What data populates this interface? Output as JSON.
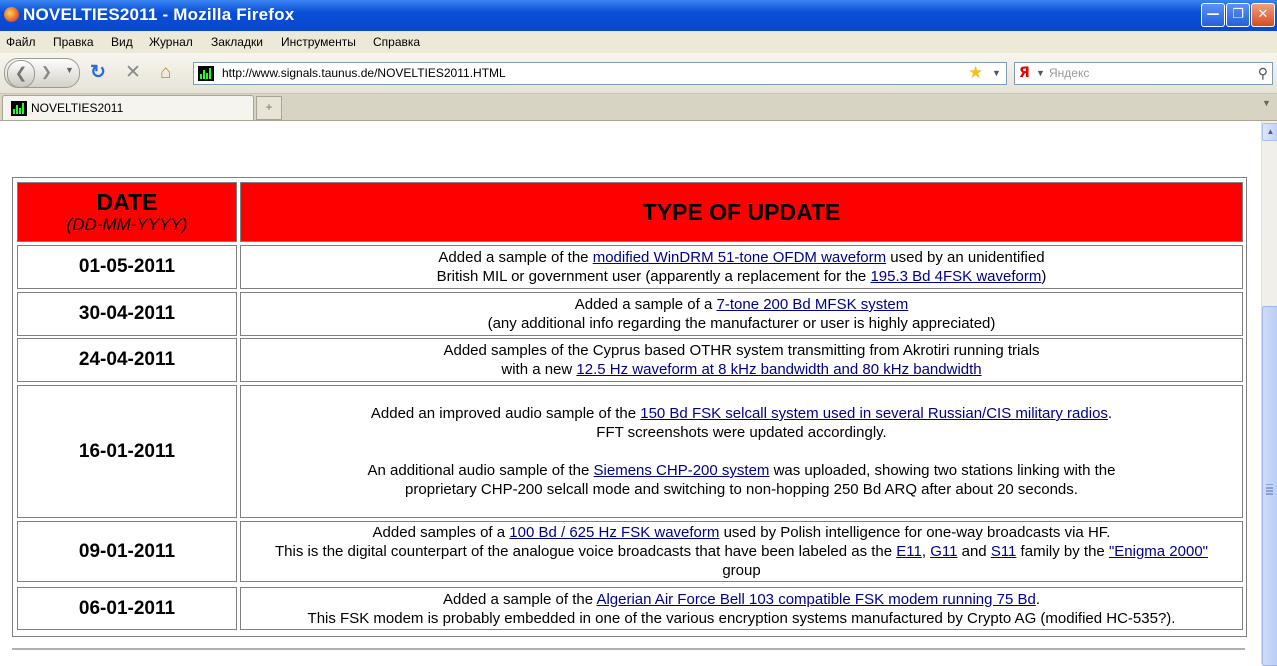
{
  "window": {
    "title": "NOVELTIES2011 - Mozilla Firefox",
    "minimize": "—",
    "maximize": "❐",
    "close": "✕"
  },
  "menu": [
    "Файл",
    "Правка",
    "Вид",
    "Журнал",
    "Закладки",
    "Инструменты",
    "Справка"
  ],
  "nav": {
    "url": "http://www.signals.taunus.de/NOVELTIES2011.HTML",
    "search_placeholder": "Яндекс",
    "search_engine": "Я"
  },
  "tabs": [
    {
      "label": "NOVELTIES2011"
    }
  ],
  "table": {
    "header": {
      "date": "DATE",
      "date_format": "(DD-MM-YYYY)",
      "type": "TYPE OF UPDATE"
    },
    "rows": [
      {
        "date": "01-05-2011",
        "lines": [
          [
            {
              "t": "Added a sample of the "
            },
            {
              "t": "modified WinDRM 51-tone OFDM waveform",
              "link": true
            },
            {
              "t": " used by an unidentified"
            }
          ],
          [
            {
              "t": "British MIL or government user (apparently a replacement for the "
            },
            {
              "t": "195.3 Bd 4FSK waveform",
              "link": true
            },
            {
              "t": ")"
            }
          ]
        ]
      },
      {
        "date": "30-04-2011",
        "lines": [
          [
            {
              "t": "Added a sample of a "
            },
            {
              "t": "7-tone 200 Bd MFSK system",
              "link": true
            }
          ],
          [
            {
              "t": "(any additional info regarding the manufacturer or user is highly appreciated)"
            }
          ]
        ]
      },
      {
        "date": "24-04-2011",
        "lines": [
          [
            {
              "t": "Added samples of the Cyprus based OTHR system transmitting from Akrotiri running trials"
            }
          ],
          [
            {
              "t": "with a new "
            },
            {
              "t": "12.5 Hz waveform at 8 kHz bandwidth and 80 kHz bandwidth",
              "link": true
            }
          ]
        ]
      },
      {
        "date": "16-01-2011",
        "lines": [
          [
            {
              "t": "Added an improved audio sample of the "
            },
            {
              "t": "150 Bd FSK selcall system used in several Russian/CIS military radios",
              "link": true
            },
            {
              "t": "."
            }
          ],
          [
            {
              "t": "FFT screenshots were updated accordingly."
            }
          ],
          [],
          [
            {
              "t": "An additional audio sample of the "
            },
            {
              "t": "Siemens CHP-200 system",
              "link": true
            },
            {
              "t": " was uploaded, showing two stations linking with the"
            }
          ],
          [
            {
              "t": "proprietary CHP-200 selcall mode and switching to non-hopping 250 Bd ARQ after about 20 seconds."
            }
          ]
        ]
      },
      {
        "date": "09-01-2011",
        "lines": [
          [
            {
              "t": "Added samples of a "
            },
            {
              "t": "100 Bd / 625 Hz FSK waveform",
              "link": true
            },
            {
              "t": " used by Polish intelligence for one-way broadcasts via HF."
            }
          ],
          [
            {
              "t": "This is the digital counterpart of the analogue voice broadcasts that have been labeled as the "
            },
            {
              "t": "E11",
              "link": true
            },
            {
              "t": ", "
            },
            {
              "t": "G11",
              "link": true
            },
            {
              "t": " and "
            },
            {
              "t": "S11",
              "link": true
            },
            {
              "t": " family by the "
            },
            {
              "t": "\"Enigma 2000\"",
              "link": true
            }
          ],
          [
            {
              "t": "group"
            }
          ]
        ]
      },
      {
        "date": "06-01-2011",
        "lines": [
          [
            {
              "t": "Added a sample of the "
            },
            {
              "t": "Algerian Air Force Bell 103 compatible FSK modem running 75 Bd",
              "link": true
            },
            {
              "t": "."
            }
          ],
          [
            {
              "t": "This FSK modem is probably embedded in one of the various encryption systems manufactured by Crypto AG (modified HC-535?)."
            }
          ]
        ]
      }
    ]
  }
}
